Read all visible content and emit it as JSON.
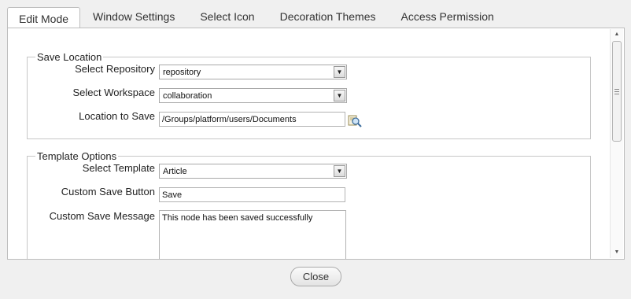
{
  "tabs": [
    {
      "label": "Edit Mode",
      "active": true
    },
    {
      "label": "Window Settings",
      "active": false
    },
    {
      "label": "Select Icon",
      "active": false
    },
    {
      "label": "Decoration Themes",
      "active": false
    },
    {
      "label": "Access Permission",
      "active": false
    }
  ],
  "save_location": {
    "legend": "Save Location",
    "repository_label": "Select Repository",
    "repository_value": "repository",
    "workspace_label": "Select Workspace",
    "workspace_value": "collaboration",
    "location_label": "Location to Save",
    "location_value": "/Groups/platform/users/Documents",
    "browse_icon": "folder-search-icon"
  },
  "template_options": {
    "legend": "Template Options",
    "template_label": "Select Template",
    "template_value": "Article",
    "save_button_label": "Custom Save Button",
    "save_button_value": "Save",
    "save_message_label": "Custom Save Message",
    "save_message_value": "This node has been saved successfully"
  },
  "footer": {
    "close_label": "Close"
  }
}
